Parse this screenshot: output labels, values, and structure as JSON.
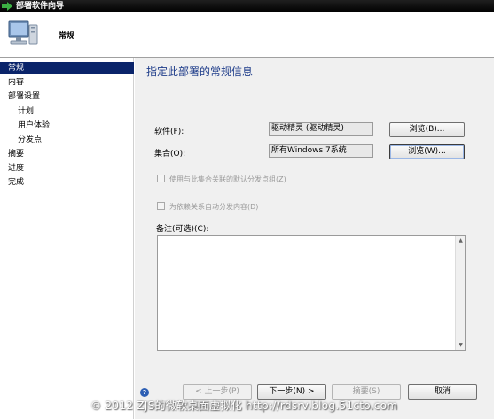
{
  "window": {
    "title": "部署软件向导"
  },
  "header": {
    "title": "常规"
  },
  "nav": {
    "items": [
      {
        "label": "常规"
      },
      {
        "label": "内容"
      },
      {
        "label": "部署设置"
      },
      {
        "label": "计划"
      },
      {
        "label": "用户体验"
      },
      {
        "label": "分发点"
      },
      {
        "label": "摘要"
      },
      {
        "label": "进度"
      },
      {
        "label": "完成"
      }
    ]
  },
  "main": {
    "heading": "指定此部署的常规信息",
    "software_label": "软件(F):",
    "software_value": "驱动精灵 (驱动精灵)",
    "collection_label": "集合(O):",
    "collection_value": "所有Windows 7系统",
    "browse_software_label": "浏览(B)...",
    "browse_collection_label": "浏览(W)...",
    "checkbox_default_dp": "使用与此集合关联的默认分发点组(Z)",
    "checkbox_auto_dependencies": "为依赖关系自动分发内容(D)",
    "notes_label": "备注(可选)(C):"
  },
  "footer": {
    "help_glyph": "?",
    "prev_label": "< 上一步(P)",
    "next_label": "下一步(N) >",
    "summary_label": "摘要(S)",
    "cancel_label": "取消"
  },
  "watermark": {
    "text": "© 2012 ZJS的微软桌面虚拟化  http://rdsrv.blog.51cto.com"
  },
  "colors": {
    "nav_selected": "#0a246a",
    "heading": "#1f3d8a",
    "titlebar": "#000000"
  }
}
